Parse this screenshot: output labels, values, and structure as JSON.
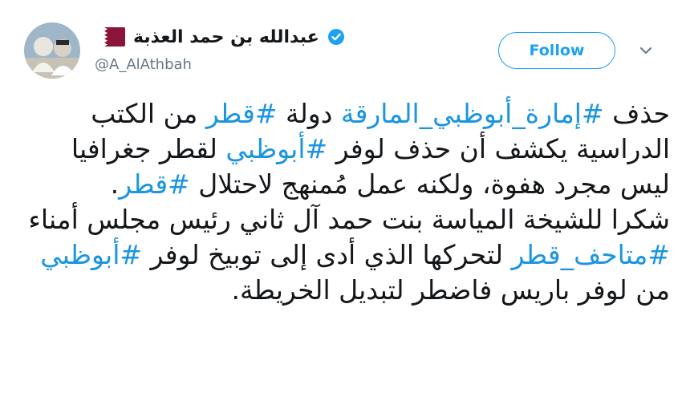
{
  "author": {
    "display_name": "عبدالله بن حمد العذبة",
    "handle": "@A_AlAthbah",
    "verified_icon": "verified-badge-icon",
    "flag_icon": "qatar-flag-icon",
    "avatar": "profile-avatar"
  },
  "actions": {
    "follow_label": "Follow",
    "menu_icon": "chevron-down-icon"
  },
  "tweet": {
    "p1_text1": "حذف ",
    "p1_tag1": "#إمارة_أبوظبي_المارقة",
    "p1_text2": " دولة ",
    "p1_tag2": "#قطر",
    "p1_text3": " من الكتب الدراسية يكشف أن حذف لوفر ",
    "p1_tag3": "#أبوظبي",
    "p1_text4": " لقطر جغرافيا ليس مجرد هفوة، ولكنه عمل مُمنهج لاحتلال ",
    "p1_tag4": "#قطر",
    "p1_text5": ".",
    "p2_text1": "شكرا للشيخة المياسة بنت حمد آل ثاني رئيس مجلس أمناء ",
    "p2_tag1": "#متاحف_قطر",
    "p2_text2": " لتحركها الذي أدى إلى توبيخ لوفر ",
    "p2_tag2": "#أبوظبي",
    "p2_text3": " من لوفر باريس فاضطر لتبديل الخريطة."
  },
  "colors": {
    "link": "#1b95e0",
    "follow": "#1da1f2",
    "text": "#14171a",
    "muted": "#657786"
  }
}
